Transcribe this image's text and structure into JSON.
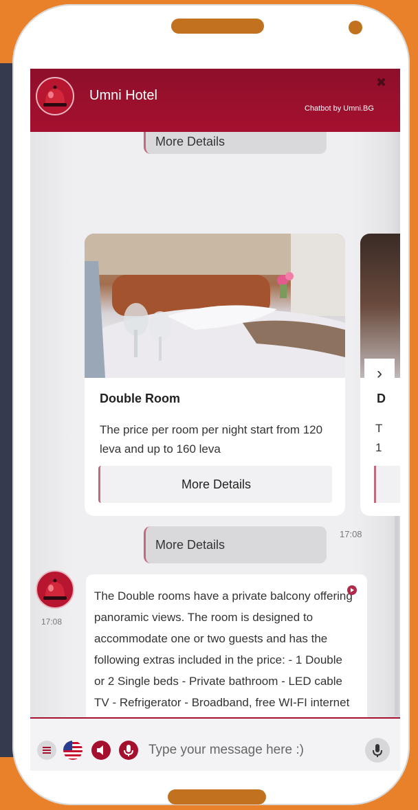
{
  "header": {
    "title": "Umni Hotel",
    "credit": "Chatbot by Umni.BG",
    "close_label": "✖"
  },
  "messages": {
    "quick_reply_top": "More Details",
    "quick_reply_main": "More Details",
    "quick_reply_time": "17:08",
    "bot_time": "17:08",
    "bot_text": "The Double rooms have a private balcony offering panoramic views. The room is designed to accommodate one or two guests and has the following extras included in the price: - 1 Double or 2 Single beds - Private bathroom - LED cable TV - Refrigerator - Broadband, free WI-FI internet - Central heating"
  },
  "carousel": {
    "card": {
      "title": "Double Room",
      "description": "The price per room per night start from 120 leva and up to 160 leva",
      "button_label": "More Details"
    },
    "next_card": {
      "title_partial": "D",
      "line1_partial": "T",
      "line2_partial": "1"
    },
    "next_arrow": "›"
  },
  "input": {
    "placeholder": "Type your message here :)"
  },
  "colors": {
    "brand": "#a5102f",
    "background": "#e8812a",
    "accent_border": "#c06a7e"
  }
}
